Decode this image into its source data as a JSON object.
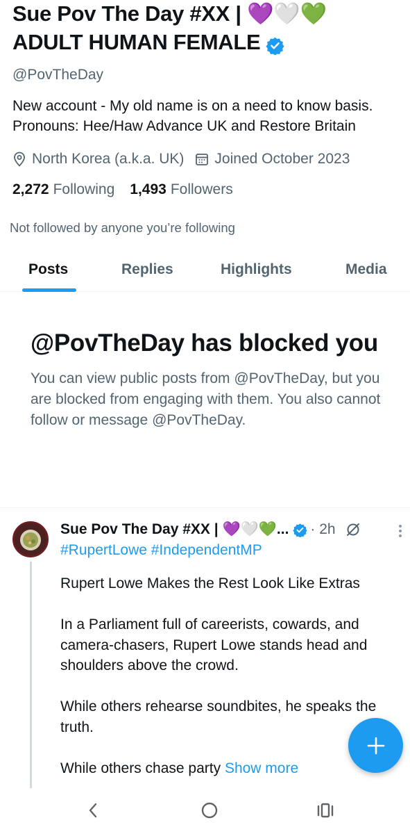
{
  "profile": {
    "name_line1": "Sue Pov The Day #XX | 💜🤍💚",
    "name_line2": "ADULT HUMAN FEMALE",
    "handle": "@PovTheDay",
    "bio_line1": "New account - My old name is on a need to know basis.",
    "bio_line2": "Pronouns: Hee/Haw Advance UK and Restore Britain",
    "location": "North Korea (a.k.a. UK)",
    "joined": "Joined October 2023",
    "following_count": "2,272",
    "following_label": "Following",
    "followers_count": "1,493",
    "followers_label": "Followers",
    "not_followed_text": "Not followed by anyone you’re following"
  },
  "tabs": [
    {
      "label": "Posts",
      "active": true
    },
    {
      "label": "Replies",
      "active": false
    },
    {
      "label": "Highlights",
      "active": false
    },
    {
      "label": "Media",
      "active": false
    }
  ],
  "blocked": {
    "title": "@PovTheDay has blocked you",
    "body": "You can view public posts from @PovTheDay, but you are blocked from engaging with them. You also cannot follow or message @PovTheDay."
  },
  "post": {
    "author": "Sue Pov The Day #XX | 💜🤍💚...",
    "time": "· 2h",
    "hashtags": "#RupertLowe #IndependentMP",
    "text": "Rupert Lowe Makes the Rest Look Like Extras\n\nIn a Parliament full of careerists, cowards, and camera-chasers, Rupert Lowe stands head and shoulders above the crowd.\n\nWhile others rehearse soundbites, he speaks the truth.\n\nWhile others chase party ",
    "show_more": "Show more"
  },
  "icons": {
    "verified": "verified-badge-icon",
    "location": "location-pin-icon",
    "calendar": "calendar-icon",
    "grok": "grok-icon",
    "more": "more-vertical-icon",
    "compose": "plus-icon",
    "back": "back-chevron-icon",
    "home": "home-circle-icon",
    "recents": "recents-icon"
  },
  "colors": {
    "accent": "#1d9bf0",
    "text_primary": "#0f1419",
    "text_secondary": "#536471"
  }
}
